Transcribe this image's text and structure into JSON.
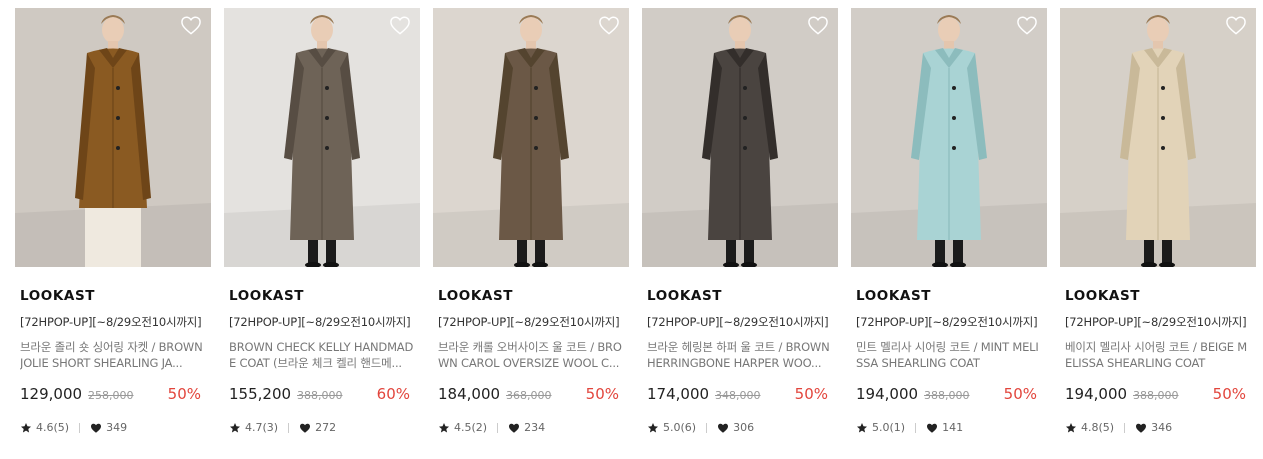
{
  "products": [
    {
      "brand": "LOOKAST",
      "promo": "[72HPOP-UP][~8/29오전10시까지]",
      "name": "브라운 졸리 숏 싱어링 자켓 / BROWN JOLIE SHORT SHEARLING JA...",
      "price": "129,000",
      "original_price": "258,000",
      "discount": "50%",
      "rating": "4.6(5)",
      "likes": "349",
      "image_icon": "coat-photo",
      "colors": {
        "bg": "#cfc9c2",
        "coat": "#8a5a22",
        "coat_dark": "#6e4518"
      }
    },
    {
      "brand": "LOOKAST",
      "promo": "[72HPOP-UP][~8/29오전10시까지]",
      "name": "BROWN CHECK KELLY HANDMADE COAT (브라운 체크 켈리 핸드메...",
      "price": "155,200",
      "original_price": "388,000",
      "discount": "60%",
      "rating": "4.7(3)",
      "likes": "272",
      "image_icon": "coat-photo",
      "colors": {
        "bg": "#e4e2df",
        "coat": "#6e6357",
        "coat_dark": "#574d43"
      }
    },
    {
      "brand": "LOOKAST",
      "promo": "[72HPOP-UP][~8/29오전10시까지]",
      "name": "브라운 캐롤 오버사이즈 울 코트 / BROWN CAROL OVERSIZE WOOL C...",
      "price": "184,000",
      "original_price": "368,000",
      "discount": "50%",
      "rating": "4.5(2)",
      "likes": "234",
      "image_icon": "coat-photo",
      "colors": {
        "bg": "#dcd6cf",
        "coat": "#6b5846",
        "coat_dark": "#54442f"
      }
    },
    {
      "brand": "LOOKAST",
      "promo": "[72HPOP-UP][~8/29오전10시까지]",
      "name": "브라운 헤링본 하퍼 울 코트 / BROWN HERRINGBONE HARPER WOO...",
      "price": "174,000",
      "original_price": "348,000",
      "discount": "50%",
      "rating": "5.0(6)",
      "likes": "306",
      "image_icon": "coat-photo",
      "colors": {
        "bg": "#d1ccc6",
        "coat": "#4a4440",
        "coat_dark": "#332e2b"
      }
    },
    {
      "brand": "LOOKAST",
      "promo": "[72HPOP-UP][~8/29오전10시까지]",
      "name": "민트 멜리사 시어링 코트 / MINT MELISSA SHEARLING COAT",
      "price": "194,000",
      "original_price": "388,000",
      "discount": "50%",
      "rating": "5.0(1)",
      "likes": "141",
      "image_icon": "coat-photo",
      "colors": {
        "bg": "#d2cdc7",
        "coat": "#a9d3d4",
        "coat_dark": "#8cbcbd"
      }
    },
    {
      "brand": "LOOKAST",
      "promo": "[72HPOP-UP][~8/29오전10시까지]",
      "name": "베이지 멜리사 시어링 코트 / BEIGE MELISSA SHEARLING COAT",
      "price": "194,000",
      "original_price": "388,000",
      "discount": "50%",
      "rating": "4.8(5)",
      "likes": "346",
      "image_icon": "coat-photo",
      "colors": {
        "bg": "#d6d0c8",
        "coat": "#e2d3b8",
        "coat_dark": "#c9b999"
      }
    }
  ],
  "icons": {
    "wishlist": "heart-outline-icon",
    "rating": "star-icon",
    "likes": "heart-filled-icon"
  },
  "colors": {
    "discount": "#e2453c",
    "brand_text": "#111111",
    "muted": "#999999"
  }
}
